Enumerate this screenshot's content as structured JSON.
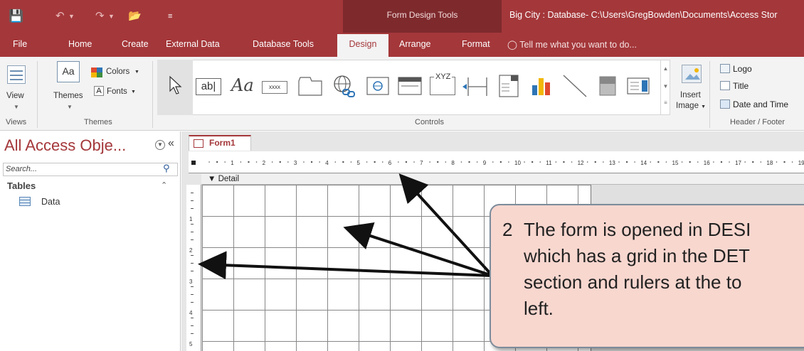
{
  "quick_access": {
    "save_icon": "save-icon",
    "undo_icon": "undo-icon",
    "redo_icon": "redo-icon",
    "open_icon": "open-folder-icon",
    "customize_icon": "customize-qat-icon"
  },
  "context_title": "Form Design Tools",
  "window_title": "Big City : Database- C:\\Users\\GregBowden\\Documents\\Access Stor",
  "tabs": {
    "file": "File",
    "home": "Home",
    "create": "Create",
    "external_data": "External Data",
    "database_tools": "Database Tools",
    "design": "Design",
    "arrange": "Arrange",
    "format": "Format"
  },
  "tell_me": "Tell me what you want to do...",
  "ribbon": {
    "views": {
      "view_label": "View",
      "group_label": "Views"
    },
    "themes": {
      "themes_label": "Themes",
      "colors_label": "Colors",
      "fonts_label": "Fonts",
      "group_label": "Themes"
    },
    "controls": {
      "textbox_glyph": "ab|",
      "label_glyph": "Aa",
      "button_glyph": "xxxx",
      "xyz_glyph": "XYZ",
      "group_label": "Controls"
    },
    "insert_image": {
      "label_line1": "Insert",
      "label_line2": "Image"
    },
    "header_footer": {
      "logo": "Logo",
      "title": "Title",
      "date_time": "Date and Time",
      "group_label": "Header / Footer"
    }
  },
  "nav_pane": {
    "title": "All Access Obje...",
    "search_placeholder": "Search...",
    "section": "Tables",
    "items": [
      {
        "label": "Data"
      }
    ]
  },
  "document": {
    "tab_label": "Form1",
    "section_label": "Detail",
    "hruler_numbers": [
      "1",
      "2",
      "3",
      "4",
      "5",
      "6",
      "7",
      "8",
      "9",
      "10",
      "11",
      "12",
      "13",
      "14",
      "15",
      "16",
      "17",
      "18",
      "19"
    ],
    "vruler_numbers": [
      "1",
      "2",
      "3",
      "4",
      "5"
    ]
  },
  "callout": {
    "number": "2",
    "lines": [
      "The form is opened in DESI",
      "which has a grid in the DET",
      "section and rulers at the to",
      "left."
    ]
  },
  "colors": {
    "accent": "#a4373a",
    "callout_fill": "#f8d7cf"
  }
}
